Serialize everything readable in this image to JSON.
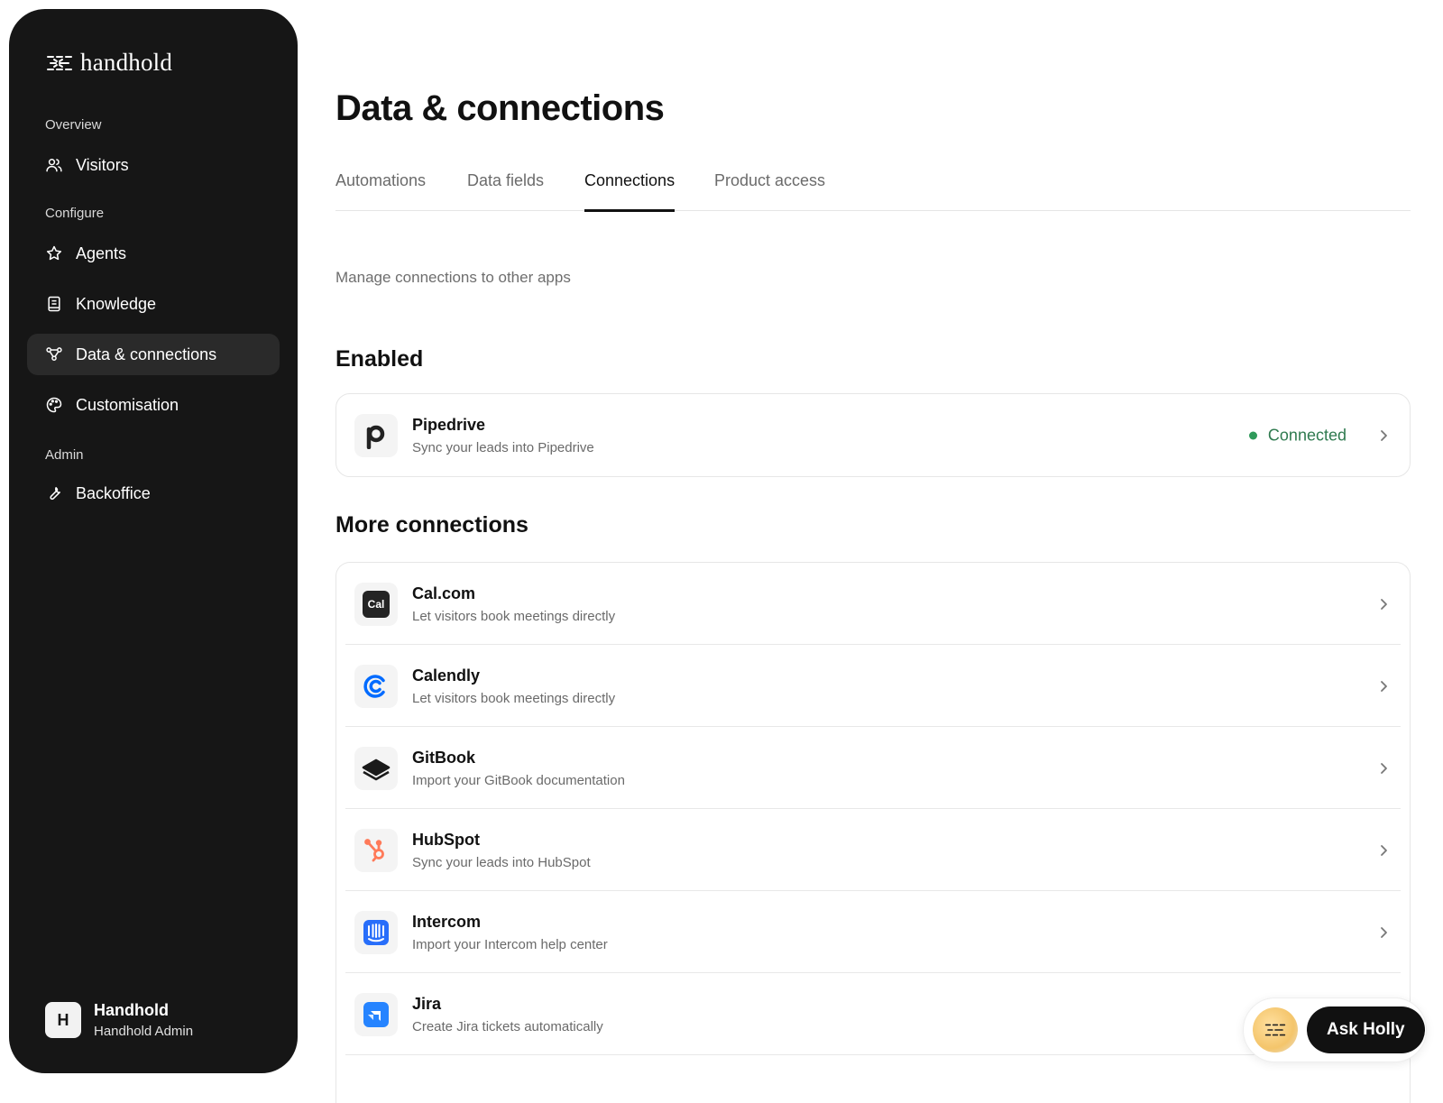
{
  "app": {
    "name": "handhold"
  },
  "sidebar": {
    "sections": [
      {
        "label": "Overview"
      },
      {
        "label": "Configure"
      },
      {
        "label": "Admin"
      }
    ],
    "items": [
      {
        "label": "Visitors",
        "icon": "users-icon"
      },
      {
        "label": "Agents",
        "icon": "star-icon"
      },
      {
        "label": "Knowledge",
        "icon": "book-icon"
      },
      {
        "label": "Data & connections",
        "icon": "nodes-icon",
        "active": true
      },
      {
        "label": "Customisation",
        "icon": "palette-icon"
      },
      {
        "label": "Backoffice",
        "icon": "wrench-icon"
      }
    ],
    "user": {
      "initial": "H",
      "name": "Handhold",
      "role": "Handhold Admin"
    }
  },
  "page": {
    "title": "Data & connections",
    "tabs": [
      {
        "label": "Automations"
      },
      {
        "label": "Data fields"
      },
      {
        "label": "Connections",
        "active": true
      },
      {
        "label": "Product access"
      }
    ],
    "subtitle": "Manage connections to other apps",
    "enabled": {
      "heading": "Enabled",
      "items": [
        {
          "name": "Pipedrive",
          "desc": "Sync your leads into Pipedrive",
          "status": "Connected",
          "status_color": "#2f9a5a"
        }
      ]
    },
    "more": {
      "heading": "More connections",
      "items": [
        {
          "name": "Cal.com",
          "desc": "Let visitors book meetings directly",
          "icon_text": "Cal"
        },
        {
          "name": "Calendly",
          "desc": "Let visitors book meetings directly"
        },
        {
          "name": "GitBook",
          "desc": "Import your GitBook documentation"
        },
        {
          "name": "HubSpot",
          "desc": "Sync your leads into HubSpot"
        },
        {
          "name": "Intercom",
          "desc": "Import your Intercom help center"
        },
        {
          "name": "Jira",
          "desc": "Create Jira tickets automatically"
        }
      ]
    }
  },
  "assistant": {
    "button_label": "Ask Holly"
  },
  "colors": {
    "sidebar_bg": "#161616",
    "connected": "#2f9a5a",
    "hubspot": "#ff7a59",
    "calendly": "#006bff",
    "intercom": "#286efa",
    "jira": "#2684ff"
  }
}
